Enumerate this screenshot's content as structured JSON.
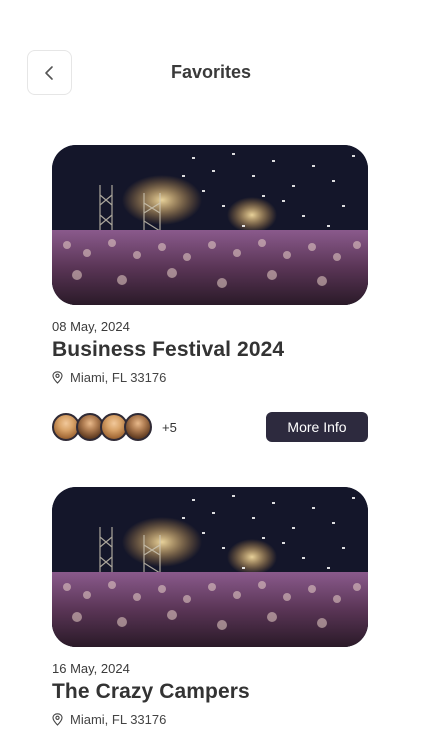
{
  "header": {
    "title": "Favorites",
    "back_icon": "chevron-left-icon"
  },
  "events": [
    {
      "date": "08 May, 2024",
      "title": "Business Festival 2024",
      "location": "Miami, FL 33176",
      "attendees_extra": "+5",
      "more_info_label": "More Info"
    },
    {
      "date": "16 May, 2024",
      "title": "The Crazy Campers",
      "location": "Miami, FL 33176"
    }
  ],
  "colors": {
    "button_bg": "#2d2a3e",
    "text": "#333333"
  }
}
